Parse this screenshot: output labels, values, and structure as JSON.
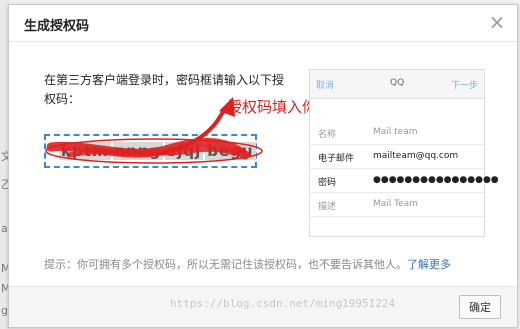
{
  "background": {
    "fragments": [
      "",
      "文",
      "乙",
      "a",
      "M",
      "M",
      "g"
    ]
  },
  "modal": {
    "title": "生成授权码",
    "close_glyph": "×",
    "instruction": "在第三方客户端登录时，密码框请输入以下授权码：",
    "auth_code_words": [
      "kptm",
      "nnng",
      "sjqj",
      "begu"
    ],
    "annotation": "授权码填入你的测试类中",
    "phone": {
      "cancel": "取消",
      "title": "QQ",
      "next": "下一步",
      "rows": [
        {
          "label": "名称",
          "value": "Mail team"
        },
        {
          "label": "电子邮件",
          "value": "mailteam@qq.com"
        },
        {
          "label": "密码",
          "value": "●●●●●●●●●●●●●●●●"
        },
        {
          "label": "描述",
          "value": "Mail Team"
        }
      ]
    },
    "hint_text": "提示：你可拥有多个授权码，所以无需记住该授权码，也不要告诉其他人。",
    "hint_link": "了解更多",
    "ok_button": "确定"
  },
  "watermark": "https://blog.csdn.net/ming19951224",
  "colors": {
    "accent_blue": "#3b8ad1",
    "annotation_red": "#e02020",
    "link_blue": "#3b6fb6"
  }
}
